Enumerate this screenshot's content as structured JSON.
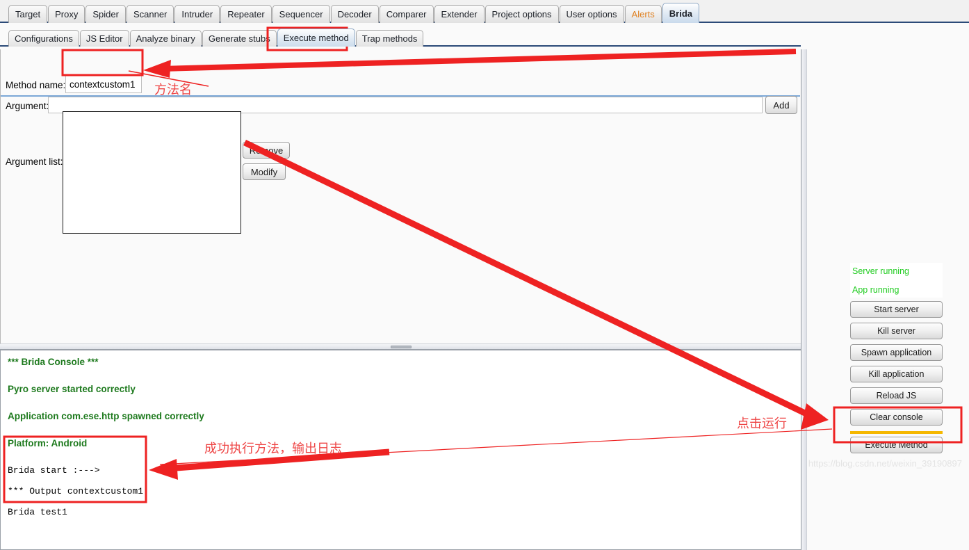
{
  "window": {
    "app_name": "Brida",
    "accent_active_tab": "#c9daec",
    "alert_tab_color": "#e08020",
    "annotation_color": "#ee2222",
    "console_text_color": "#1e7a1e",
    "status_text_color": "#22cc22",
    "highlight_rule_color": "#f5b800"
  },
  "outer_tabs": [
    {
      "label": "Target",
      "active": false,
      "style": "normal"
    },
    {
      "label": "Proxy",
      "active": false,
      "style": "normal"
    },
    {
      "label": "Spider",
      "active": false,
      "style": "normal"
    },
    {
      "label": "Scanner",
      "active": false,
      "style": "normal"
    },
    {
      "label": "Intruder",
      "active": false,
      "style": "normal"
    },
    {
      "label": "Repeater",
      "active": false,
      "style": "normal"
    },
    {
      "label": "Sequencer",
      "active": false,
      "style": "normal"
    },
    {
      "label": "Decoder",
      "active": false,
      "style": "normal"
    },
    {
      "label": "Comparer",
      "active": false,
      "style": "normal"
    },
    {
      "label": "Extender",
      "active": false,
      "style": "normal"
    },
    {
      "label": "Project options",
      "active": false,
      "style": "normal"
    },
    {
      "label": "User options",
      "active": false,
      "style": "normal"
    },
    {
      "label": "Alerts",
      "active": false,
      "style": "alerts"
    },
    {
      "label": "Brida",
      "active": true,
      "style": "normal"
    }
  ],
  "inner_tabs": [
    {
      "label": "Configurations",
      "active": false
    },
    {
      "label": "JS Editor",
      "active": false
    },
    {
      "label": "Analyze binary",
      "active": false
    },
    {
      "label": "Generate stubs",
      "active": false
    },
    {
      "label": "Execute method",
      "active": true
    },
    {
      "label": "Trap methods",
      "active": false
    }
  ],
  "form": {
    "method_name_label": "Method name:",
    "method_name_value": "contextcustom1",
    "method_name_placeholder": "",
    "argument_label": "Argument:",
    "argument_value": "",
    "argument_placeholder": "",
    "add_label": "Add",
    "argument_list_label": "Argument list:",
    "argument_list_items": [],
    "remove_label": "Remove",
    "modify_label": "Modify"
  },
  "console": {
    "lines": [
      "*** Brida Console ***",
      "Pyro server started correctly",
      "Application com.ese.http spawned correctly",
      "Platform: Android"
    ],
    "output_lines": [
      "Brida start :--->",
      "*** Output contextcustom1:",
      "Brida test1"
    ]
  },
  "sidebar": {
    "status": [
      "Server running",
      "App running"
    ],
    "buttons": [
      "Start server",
      "Kill server",
      "Spawn application",
      "Kill application",
      "Reload JS",
      "Clear console",
      "Execute Method"
    ]
  },
  "annotations": {
    "method_name_note": "方法名",
    "execute_note": "点击运行",
    "output_note": "成功执行方法，输出日志"
  },
  "watermark": "https://blog.csdn.net/weixin_39190897"
}
